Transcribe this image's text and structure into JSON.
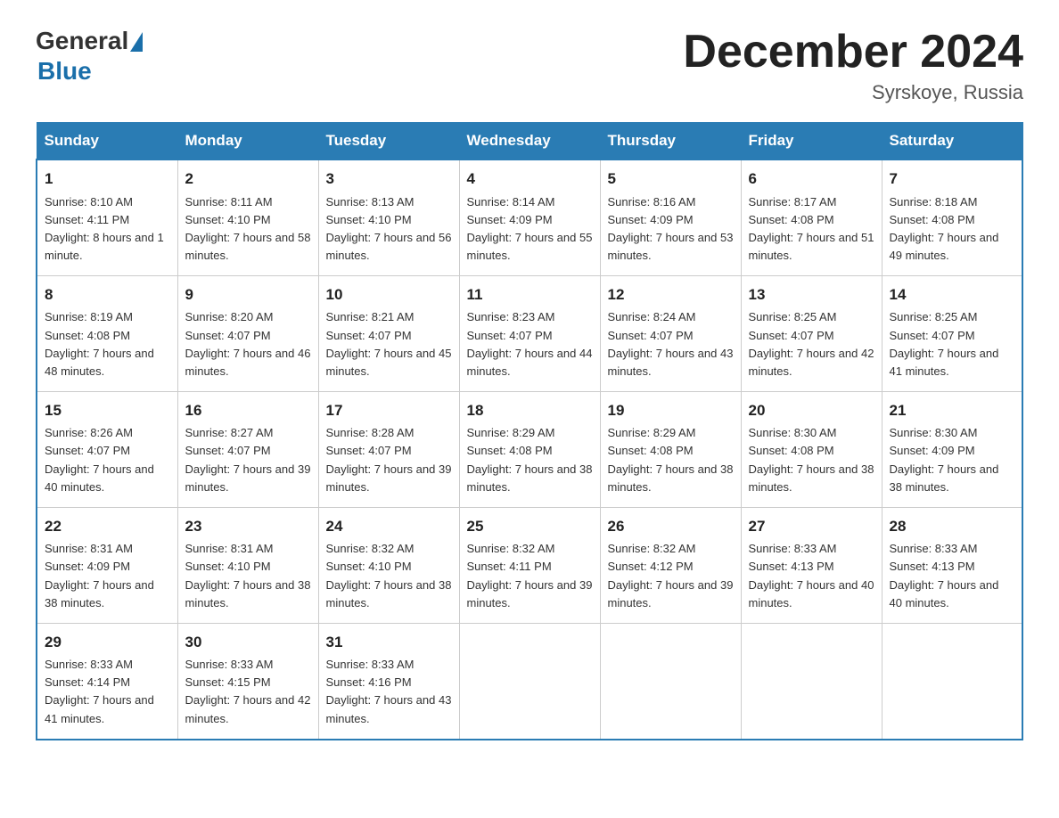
{
  "logo": {
    "general": "General",
    "blue": "Blue"
  },
  "title": "December 2024",
  "subtitle": "Syrskoye, Russia",
  "days_of_week": [
    "Sunday",
    "Monday",
    "Tuesday",
    "Wednesday",
    "Thursday",
    "Friday",
    "Saturday"
  ],
  "weeks": [
    [
      {
        "num": "1",
        "sunrise": "8:10 AM",
        "sunset": "4:11 PM",
        "daylight": "8 hours and 1 minute."
      },
      {
        "num": "2",
        "sunrise": "8:11 AM",
        "sunset": "4:10 PM",
        "daylight": "7 hours and 58 minutes."
      },
      {
        "num": "3",
        "sunrise": "8:13 AM",
        "sunset": "4:10 PM",
        "daylight": "7 hours and 56 minutes."
      },
      {
        "num": "4",
        "sunrise": "8:14 AM",
        "sunset": "4:09 PM",
        "daylight": "7 hours and 55 minutes."
      },
      {
        "num": "5",
        "sunrise": "8:16 AM",
        "sunset": "4:09 PM",
        "daylight": "7 hours and 53 minutes."
      },
      {
        "num": "6",
        "sunrise": "8:17 AM",
        "sunset": "4:08 PM",
        "daylight": "7 hours and 51 minutes."
      },
      {
        "num": "7",
        "sunrise": "8:18 AM",
        "sunset": "4:08 PM",
        "daylight": "7 hours and 49 minutes."
      }
    ],
    [
      {
        "num": "8",
        "sunrise": "8:19 AM",
        "sunset": "4:08 PM",
        "daylight": "7 hours and 48 minutes."
      },
      {
        "num": "9",
        "sunrise": "8:20 AM",
        "sunset": "4:07 PM",
        "daylight": "7 hours and 46 minutes."
      },
      {
        "num": "10",
        "sunrise": "8:21 AM",
        "sunset": "4:07 PM",
        "daylight": "7 hours and 45 minutes."
      },
      {
        "num": "11",
        "sunrise": "8:23 AM",
        "sunset": "4:07 PM",
        "daylight": "7 hours and 44 minutes."
      },
      {
        "num": "12",
        "sunrise": "8:24 AM",
        "sunset": "4:07 PM",
        "daylight": "7 hours and 43 minutes."
      },
      {
        "num": "13",
        "sunrise": "8:25 AM",
        "sunset": "4:07 PM",
        "daylight": "7 hours and 42 minutes."
      },
      {
        "num": "14",
        "sunrise": "8:25 AM",
        "sunset": "4:07 PM",
        "daylight": "7 hours and 41 minutes."
      }
    ],
    [
      {
        "num": "15",
        "sunrise": "8:26 AM",
        "sunset": "4:07 PM",
        "daylight": "7 hours and 40 minutes."
      },
      {
        "num": "16",
        "sunrise": "8:27 AM",
        "sunset": "4:07 PM",
        "daylight": "7 hours and 39 minutes."
      },
      {
        "num": "17",
        "sunrise": "8:28 AM",
        "sunset": "4:07 PM",
        "daylight": "7 hours and 39 minutes."
      },
      {
        "num": "18",
        "sunrise": "8:29 AM",
        "sunset": "4:08 PM",
        "daylight": "7 hours and 38 minutes."
      },
      {
        "num": "19",
        "sunrise": "8:29 AM",
        "sunset": "4:08 PM",
        "daylight": "7 hours and 38 minutes."
      },
      {
        "num": "20",
        "sunrise": "8:30 AM",
        "sunset": "4:08 PM",
        "daylight": "7 hours and 38 minutes."
      },
      {
        "num": "21",
        "sunrise": "8:30 AM",
        "sunset": "4:09 PM",
        "daylight": "7 hours and 38 minutes."
      }
    ],
    [
      {
        "num": "22",
        "sunrise": "8:31 AM",
        "sunset": "4:09 PM",
        "daylight": "7 hours and 38 minutes."
      },
      {
        "num": "23",
        "sunrise": "8:31 AM",
        "sunset": "4:10 PM",
        "daylight": "7 hours and 38 minutes."
      },
      {
        "num": "24",
        "sunrise": "8:32 AM",
        "sunset": "4:10 PM",
        "daylight": "7 hours and 38 minutes."
      },
      {
        "num": "25",
        "sunrise": "8:32 AM",
        "sunset": "4:11 PM",
        "daylight": "7 hours and 39 minutes."
      },
      {
        "num": "26",
        "sunrise": "8:32 AM",
        "sunset": "4:12 PM",
        "daylight": "7 hours and 39 minutes."
      },
      {
        "num": "27",
        "sunrise": "8:33 AM",
        "sunset": "4:13 PM",
        "daylight": "7 hours and 40 minutes."
      },
      {
        "num": "28",
        "sunrise": "8:33 AM",
        "sunset": "4:13 PM",
        "daylight": "7 hours and 40 minutes."
      }
    ],
    [
      {
        "num": "29",
        "sunrise": "8:33 AM",
        "sunset": "4:14 PM",
        "daylight": "7 hours and 41 minutes."
      },
      {
        "num": "30",
        "sunrise": "8:33 AM",
        "sunset": "4:15 PM",
        "daylight": "7 hours and 42 minutes."
      },
      {
        "num": "31",
        "sunrise": "8:33 AM",
        "sunset": "4:16 PM",
        "daylight": "7 hours and 43 minutes."
      },
      null,
      null,
      null,
      null
    ]
  ]
}
